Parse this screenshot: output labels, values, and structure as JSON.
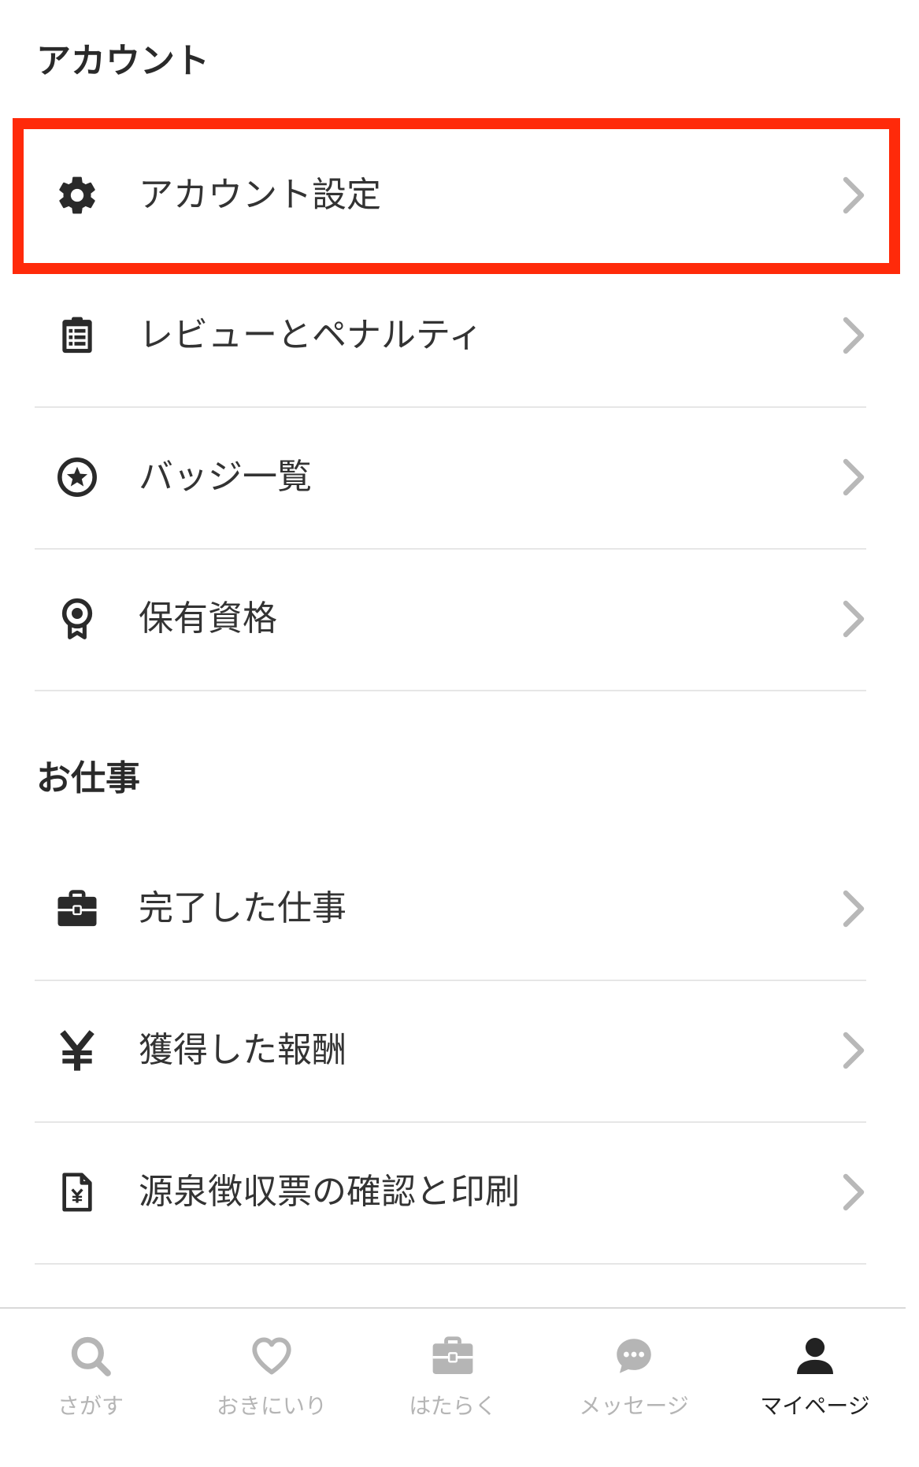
{
  "sections": {
    "account": {
      "title": "アカウント",
      "items": [
        {
          "label": "アカウント設定",
          "icon": "gear-icon"
        },
        {
          "label": "レビューとペナルティ",
          "icon": "clipboard-list-icon"
        },
        {
          "label": "バッジ一覧",
          "icon": "star-circle-icon"
        },
        {
          "label": "保有資格",
          "icon": "award-ribbon-icon"
        }
      ]
    },
    "work": {
      "title": "お仕事",
      "items": [
        {
          "label": "完了した仕事",
          "icon": "briefcase-icon"
        },
        {
          "label": "獲得した報酬",
          "icon": "yen-icon"
        },
        {
          "label": "源泉徴収票の確認と印刷",
          "icon": "yen-document-icon"
        }
      ]
    }
  },
  "tabbar": {
    "items": [
      {
        "label": "さがす",
        "icon": "search-icon",
        "active": false
      },
      {
        "label": "おきにいり",
        "icon": "heart-icon",
        "active": false
      },
      {
        "label": "はたらく",
        "icon": "briefcase-icon",
        "active": false
      },
      {
        "label": "メッセージ",
        "icon": "chat-bubble-icon",
        "active": false
      },
      {
        "label": "マイページ",
        "icon": "user-icon",
        "active": true
      }
    ]
  },
  "colors": {
    "highlight": "#ff2a0a",
    "icon": "#2a2a2a",
    "chevron": "#b8b8b8",
    "tab_inactive": "#b5b5b5",
    "tab_active": "#222222"
  }
}
